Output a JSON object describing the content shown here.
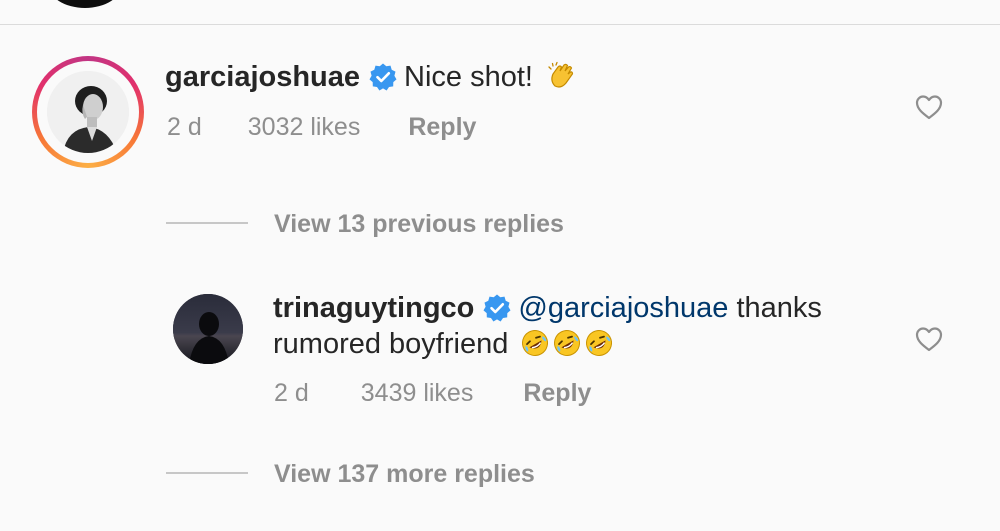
{
  "comments": [
    {
      "username": "garciajoshuae",
      "verified": true,
      "text": "Nice shot!",
      "emoji": "clapping-hands",
      "time": "2 d",
      "likes": "3032 likes",
      "reply_label": "Reply"
    },
    {
      "username": "trinaguytingco",
      "verified": true,
      "mention": "@garciajoshuae",
      "text_line1": " thanks",
      "text_line2": "rumored boyfriend",
      "emojis": [
        "rolling-on-floor-laughing",
        "rolling-on-floor-laughing",
        "rolling-on-floor-laughing"
      ],
      "time": "2 d",
      "likes": "3439 likes",
      "reply_label": "Reply"
    }
  ],
  "view_previous_replies": "View 13 previous replies",
  "view_more_replies": "View 137 more replies",
  "colors": {
    "background": "#fafafa",
    "text": "#262626",
    "secondary": "#8e8e8e",
    "verified_blue": "#3897f0",
    "mention": "#00376b"
  },
  "icons": [
    "heart-outline-icon",
    "verified-badge-icon"
  ]
}
